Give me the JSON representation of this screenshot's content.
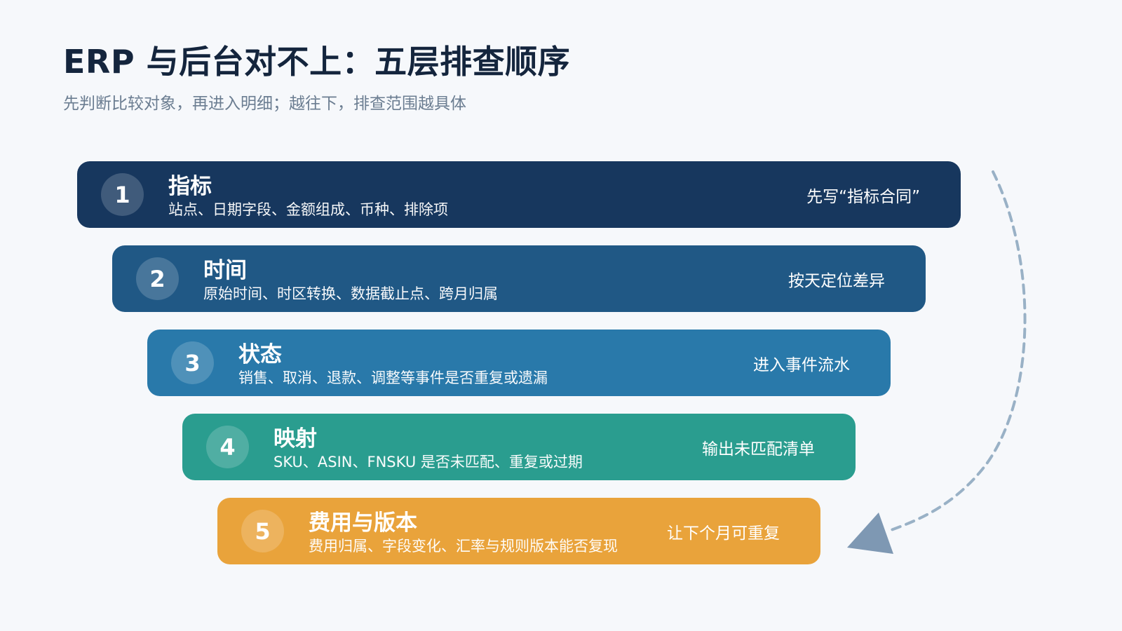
{
  "header": {
    "title": "ERP 与后台对不上：五层排查顺序",
    "subtitle": "先判断比较对象，再进入明细；越往下，排查范围越具体"
  },
  "layers": [
    {
      "number": "1",
      "title": "指标",
      "detail": "站点、日期字段、金额组成、币种、排除项",
      "action": "先写“指标合同”",
      "color": "#17375e"
    },
    {
      "number": "2",
      "title": "时间",
      "detail": "原始时间、时区转换、数据截止点、跨月归属",
      "action": "按天定位差异",
      "color": "#205885"
    },
    {
      "number": "3",
      "title": "状态",
      "detail": "销售、取消、退款、调整等事件是否重复或遗漏",
      "action": "进入事件流水",
      "color": "#2979aa"
    },
    {
      "number": "4",
      "title": "映射",
      "detail": "SKU、ASIN、FNSKU 是否未匹配、重复或过期",
      "action": "输出未匹配清单",
      "color": "#2a9d8f"
    },
    {
      "number": "5",
      "title": "费用与版本",
      "detail": "费用归属、字段变化、汇率与规则版本能否复现",
      "action": "让下个月可重复",
      "color": "#e9a33b"
    }
  ],
  "colors": {
    "background": "#f6f8fb",
    "title": "#14253d",
    "subtitle": "#6b7d91",
    "arrow": "#8fa8c0"
  }
}
